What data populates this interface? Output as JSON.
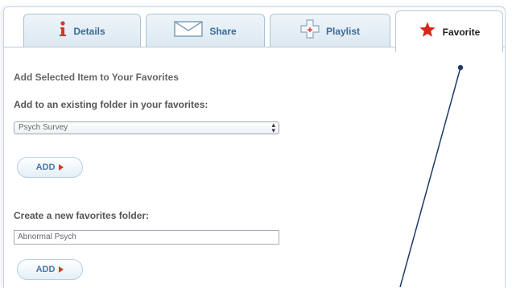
{
  "tabs": [
    {
      "label": "Details",
      "icon": "info-icon"
    },
    {
      "label": "Share",
      "icon": "envelope-icon"
    },
    {
      "label": "Playlist",
      "icon": "plus-icon"
    },
    {
      "label": "Favorite",
      "icon": "star-icon"
    }
  ],
  "active_tab": "Favorite",
  "favorites": {
    "heading": "Add Selected Item to Your Favorites",
    "existing_label": "Add to an existing folder in your favorites:",
    "existing_selected": "Psych Survey",
    "add_label": "ADD",
    "new_label": "Create a new favorites folder:",
    "new_value": "Abnormal Psych",
    "add2_label": "ADD"
  },
  "colors": {
    "tab_text": "#3b6b99",
    "accent_red": "#d03a2a",
    "border": "#a9c3d6"
  }
}
